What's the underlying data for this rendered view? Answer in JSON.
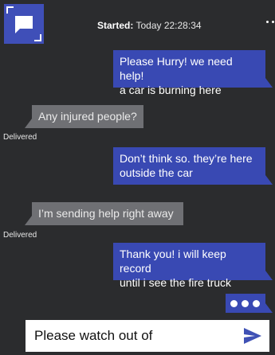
{
  "header": {
    "started_label": "Started:",
    "started_time": "Today 22:28:34",
    "logo_icon": "chat-bubble-icon",
    "more_icon": "more-dots-icon"
  },
  "messages": [
    {
      "direction": "outgoing",
      "text": "Please Hurry! we need help!\na car is burning here"
    },
    {
      "direction": "incoming",
      "text": "Any injured people?",
      "status": "Delivered"
    },
    {
      "direction": "outgoing",
      "text": "Don’t think so. they’re here\noutside the car"
    },
    {
      "direction": "incoming",
      "text": "I’m sending help right away",
      "status": "Delivered"
    },
    {
      "direction": "outgoing",
      "text": "Thank you! i will keep record\nuntil i see the fire truck"
    }
  ],
  "typing_indicator": {
    "icon": "typing-dots-icon"
  },
  "composer": {
    "value": "Please watch out of ",
    "send_icon": "send-icon"
  },
  "colors": {
    "background": "#2b2c2e",
    "outgoing_bubble": "#3949b3",
    "incoming_bubble": "#6f7074",
    "send_icon": "#3f51b5"
  }
}
